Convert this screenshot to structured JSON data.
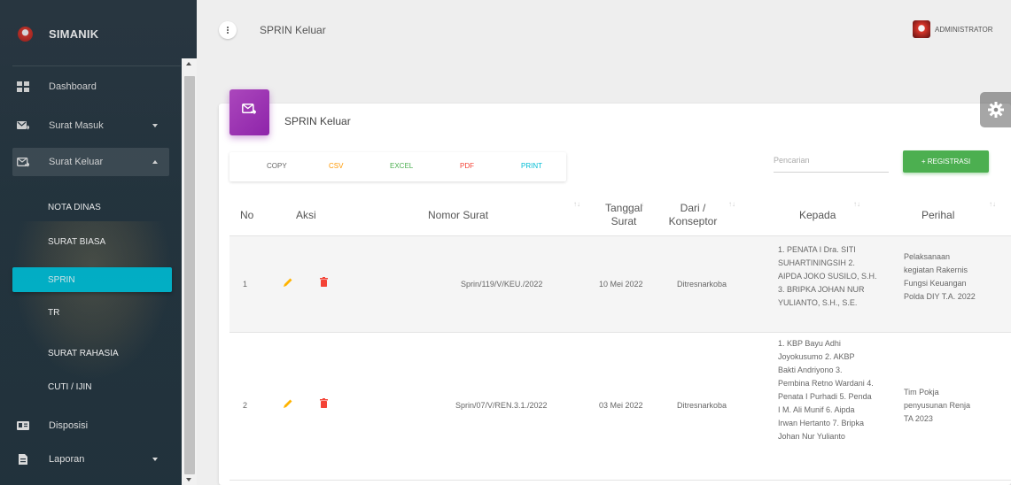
{
  "app": {
    "name": "SIMANIK",
    "page_title": "SPRIN Keluar",
    "user": "ADMINISTRATOR"
  },
  "sidebar": {
    "items": [
      {
        "label": "Dashboard",
        "icon": "dashboard-icon"
      },
      {
        "label": "Surat Masuk",
        "icon": "inbox-icon",
        "caret": "down"
      },
      {
        "label": "Surat Keluar",
        "icon": "outbox-icon",
        "caret": "up"
      },
      {
        "label": "Disposisi",
        "icon": "disposisi-icon"
      },
      {
        "label": "Laporan",
        "icon": "report-icon",
        "caret": "down"
      }
    ],
    "submenu": [
      "NOTA DINAS",
      "SURAT BIASA",
      "SPRIN",
      "TR",
      "SURAT RAHASIA",
      "CUTI / IJIN"
    ],
    "active_submenu": "SPRIN"
  },
  "card": {
    "title": "SPRIN Keluar",
    "export_buttons": [
      {
        "label": "COPY",
        "color": "#666666"
      },
      {
        "label": "CSV",
        "color": "#ff9800"
      },
      {
        "label": "EXCEL",
        "color": "#4caf50"
      },
      {
        "label": "PDF",
        "color": "#f44336"
      },
      {
        "label": "PRINT",
        "color": "#00bcd4"
      }
    ],
    "search_placeholder": "Pencarian",
    "register_button": "+ REGISTRASI"
  },
  "table": {
    "headers": {
      "no": "No",
      "aksi": "Aksi",
      "nomor": "Nomor Surat",
      "tanggal_1": "Tanggal",
      "tanggal_2": "Surat",
      "dari_1": "Dari /",
      "dari_2": "Konseptor",
      "kepada": "Kepada",
      "perihal": "Perihal"
    },
    "rows": [
      {
        "no": "1",
        "nomor": "Sprin/119/V/KEU./2022",
        "tanggal": "10 Mei 2022",
        "dari": "Ditresnarkoba",
        "kepada": [
          "1. PENATA I Dra. SITI",
          "SUHARTININGSIH 2.",
          "AIPDA JOKO SUSILO, S.H.",
          "3. BRIPKA JOHAN NUR",
          "YULIANTO, S.H., S.E."
        ],
        "perihal": [
          "Pelaksanaan",
          "kegiatan Rakernis",
          "Fungsi Keuangan",
          "Polda DIY T.A. 2022"
        ]
      },
      {
        "no": "2",
        "nomor": "Sprin/07/V/REN.3.1./2022",
        "tanggal": "03 Mei 2022",
        "dari": "Ditresnarkoba",
        "kepada": [
          "1. KBP Bayu Adhi",
          "Joyokusumo 2. AKBP",
          "Bakti Andriyono 3.",
          "Pembina Retno Wardani 4.",
          "Penata I Purhadi 5. Penda",
          "I M. Ali Munif 6. Aipda",
          "Irwan Hertanto 7. Bripka",
          "Johan Nur Yulianto"
        ],
        "perihal": [
          "Tim Pokja",
          "penyusunan Renja",
          "TA 2023"
        ]
      }
    ]
  },
  "colors": {
    "accent": "#00bcd4",
    "card_icon": "#9c27b0",
    "register": "#4caf50",
    "edit": "#ffb300",
    "delete": "#f44336"
  }
}
